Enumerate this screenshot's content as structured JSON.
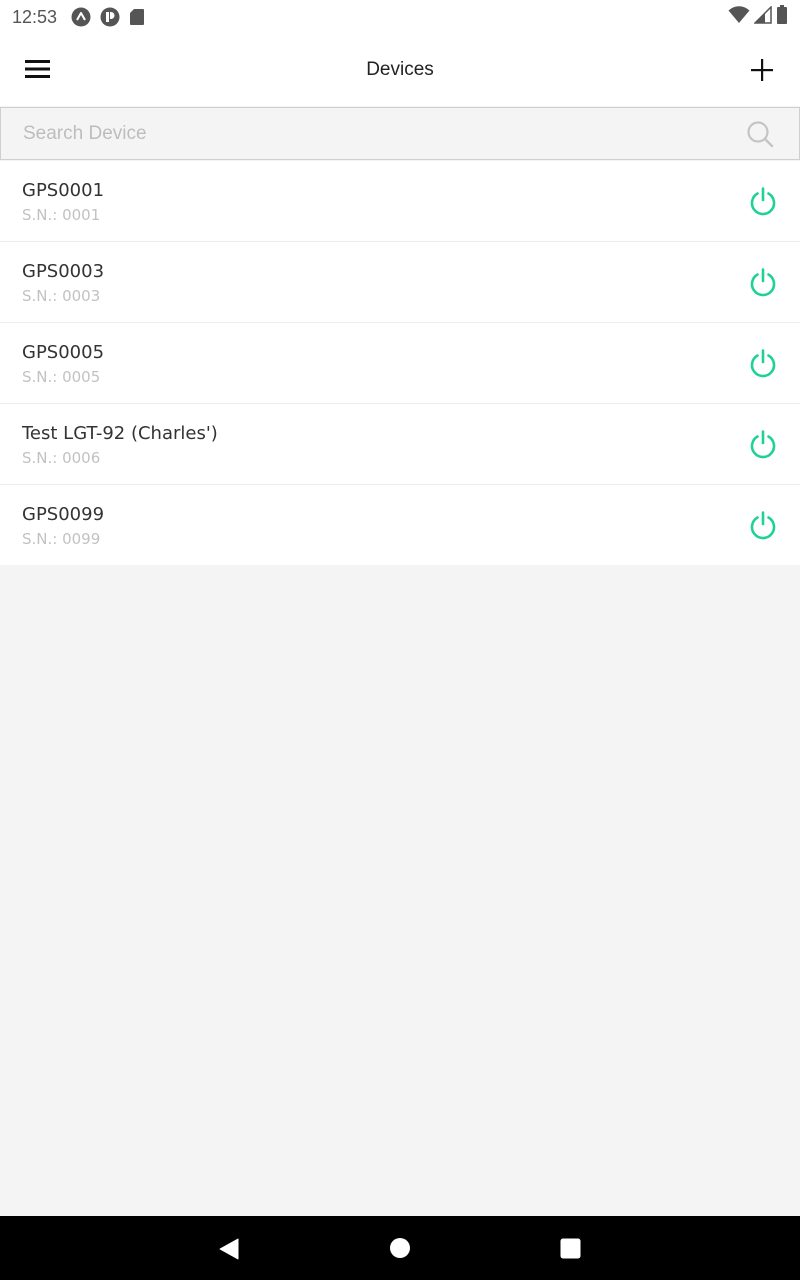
{
  "status_bar": {
    "time": "12:53",
    "notification_icons": [
      "app-a-icon",
      "app-p-icon",
      "sd-card-icon"
    ],
    "system_icons": [
      "wifi-icon",
      "cellular-signal-icon",
      "battery-icon"
    ]
  },
  "header": {
    "title": "Devices",
    "menu_icon": "hamburger-menu-icon",
    "add_icon": "plus-icon"
  },
  "search": {
    "placeholder": "Search Device",
    "value": "",
    "icon": "search-icon"
  },
  "devices": [
    {
      "name": "GPS0001",
      "serial": "S.N.: 0001",
      "status": "on"
    },
    {
      "name": "GPS0003",
      "serial": "S.N.: 0003",
      "status": "on"
    },
    {
      "name": "GPS0005",
      "serial": "S.N.: 0005",
      "status": "on"
    },
    {
      "name": "Test LGT-92 (Charles')",
      "serial": "S.N.: 0006",
      "status": "on"
    },
    {
      "name": "GPS0099",
      "serial": "S.N.: 0099",
      "status": "on"
    }
  ],
  "colors": {
    "power_on": "#1fd196",
    "background": "#f4f4f4",
    "header_bg": "#ffffff",
    "nav_bar_bg": "#000000"
  },
  "nav_bar": {
    "buttons": [
      "back-icon",
      "home-icon",
      "recents-icon"
    ]
  }
}
